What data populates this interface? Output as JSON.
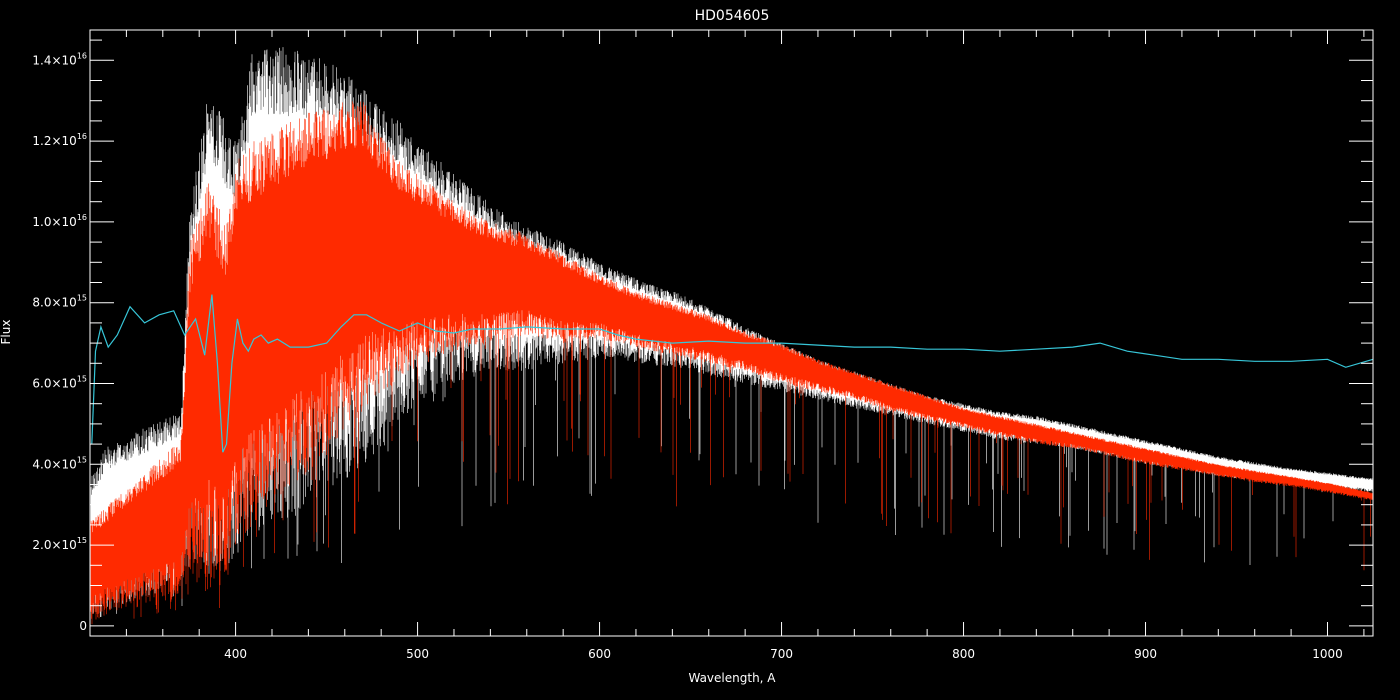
{
  "chart_data": {
    "type": "line",
    "title": "HD054605",
    "xlabel": "Wavelength, A",
    "ylabel": "Flux",
    "xlim": [
      320,
      1025
    ],
    "ylim": [
      -250000000000000.0,
      1.475e+16
    ],
    "grid": false,
    "x_ticks": [
      {
        "value": 400,
        "label": "400"
      },
      {
        "value": 500,
        "label": "500"
      },
      {
        "value": 600,
        "label": "600"
      },
      {
        "value": 700,
        "label": "700"
      },
      {
        "value": 800,
        "label": "800"
      },
      {
        "value": 900,
        "label": "900"
      },
      {
        "value": 1000,
        "label": "1000"
      }
    ],
    "y_ticks": [
      {
        "value": 0,
        "mantissa": "0",
        "exponent": ""
      },
      {
        "value": 2000000000000000.0,
        "mantissa": "2.0×10",
        "exponent": "15"
      },
      {
        "value": 4000000000000000.0,
        "mantissa": "4.0×10",
        "exponent": "15"
      },
      {
        "value": 6000000000000000.0,
        "mantissa": "6.0×10",
        "exponent": "15"
      },
      {
        "value": 8000000000000000.0,
        "mantissa": "8.0×10",
        "exponent": "15"
      },
      {
        "value": 1e+16,
        "mantissa": "1.0×10",
        "exponent": "16"
      },
      {
        "value": 1.2e+16,
        "mantissa": "1.2×10",
        "exponent": "16"
      },
      {
        "value": 1.4e+16,
        "mantissa": "1.4×10",
        "exponent": "16"
      }
    ],
    "series": [
      {
        "color": "#ffffff",
        "envelope_upper": {
          "x": [
            321,
            330,
            350,
            370,
            375,
            385,
            395,
            400,
            410,
            420,
            430,
            440,
            450,
            460,
            470,
            480,
            490,
            500,
            520,
            540,
            560,
            580,
            600,
            620,
            640,
            660,
            680,
            700,
            720,
            740,
            760,
            780,
            800,
            820,
            840,
            860,
            880,
            900,
            920,
            940,
            960,
            980,
            1000,
            1025
          ],
          "y": [
            3800000000000000.0,
            4500000000000000.0,
            4900000000000000.0,
            5300000000000000.0,
            1.05e+16,
            1.32e+16,
            1.25e+16,
            1.2e+16,
            1.44e+16,
            1.44e+16,
            1.43e+16,
            1.42e+16,
            1.4e+16,
            1.37e+16,
            1.33e+16,
            1.28e+16,
            1.25e+16,
            1.2e+16,
            1.12e+16,
            1.05e+16,
            9900000000000000.0,
            9500000000000000.0,
            9000000000000000.0,
            8600000000000000.0,
            8300000000000000.0,
            7900000000000000.0,
            7400000000000000.0,
            7000000000000000.0,
            6600000000000000.0,
            6300000000000000.0,
            6000000000000000.0,
            5700000000000000.0,
            5500000000000000.0,
            5300000000000000.0,
            5200000000000000.0,
            5000000000000000.0,
            4800000000000000.0,
            4600000000000000.0,
            4400000000000000.0,
            4200000000000000.0,
            4050000000000000.0,
            3900000000000000.0,
            3800000000000000.0,
            3650000000000000.0
          ]
        },
        "envelope_lower": {
          "x": [
            321,
            330,
            350,
            370,
            375,
            385,
            395,
            400,
            410,
            420,
            430,
            440,
            450,
            460,
            470,
            480,
            490,
            500,
            520,
            540,
            560,
            580,
            600,
            620,
            640,
            660,
            680,
            700,
            720,
            740,
            760,
            780,
            800,
            820,
            840,
            860,
            880,
            900,
            920,
            940,
            960,
            980,
            1000,
            1025
          ],
          "y": [
            100000000000000.0,
            400000000000000.0,
            700000000000000.0,
            1000000000000000.0,
            1500000000000000.0,
            1500000000000000.0,
            1300000000000000.0,
            1800000000000000.0,
            2300000000000000.0,
            2500000000000000.0,
            2700000000000000.0,
            3000000000000000.0,
            3400000000000000.0,
            3500000000000000.0,
            4000000000000000.0,
            4300000000000000.0,
            5000000000000000.0,
            5500000000000000.0,
            6000000000000000.0,
            6300000000000000.0,
            6300000000000000.0,
            6500000000000000.0,
            6600000000000000.0,
            6500000000000000.0,
            6400000000000000.0,
            6200000000000000.0,
            6000000000000000.0,
            5800000000000000.0,
            5600000000000000.0,
            5400000000000000.0,
            5200000000000000.0,
            5000000000000000.0,
            4800000000000000.0,
            4600000000000000.0,
            4500000000000000.0,
            4400000000000000.0,
            4200000000000000.0,
            4000000000000000.0,
            3900000000000000.0,
            3700000000000000.0,
            3600000000000000.0,
            3500000000000000.0,
            3400000000000000.0,
            3300000000000000.0
          ]
        }
      },
      {
        "color": "#ff2a00",
        "envelope_upper": {
          "x": [
            321,
            330,
            350,
            370,
            375,
            385,
            395,
            400,
            410,
            420,
            430,
            440,
            450,
            460,
            470,
            480,
            490,
            500,
            520,
            540,
            560,
            580,
            600,
            620,
            640,
            660,
            680,
            700,
            720,
            740,
            760,
            780,
            800,
            820,
            840,
            860,
            880,
            900,
            920,
            940,
            960,
            980,
            1000,
            1025
          ],
          "y": [
            2600000000000000.0,
            3000000000000000.0,
            3800000000000000.0,
            4600000000000000.0,
            9500000000000000.0,
            1.1e+16,
            1e+16,
            1.15e+16,
            1.2e+16,
            1.22e+16,
            1.25e+16,
            1.27e+16,
            1.28e+16,
            1.3e+16,
            1.3e+16,
            1.22e+16,
            1.15e+16,
            1.12e+16,
            1.05e+16,
            1e+16,
            9700000000000000.0,
            9200000000000000.0,
            8700000000000000.0,
            8300000000000000.0,
            8000000000000000.0,
            7700000000000000.0,
            7300000000000000.0,
            7000000000000000.0,
            6600000000000000.0,
            6300000000000000.0,
            6000000000000000.0,
            5700000000000000.0,
            5400000000000000.0,
            5200000000000000.0,
            5000000000000000.0,
            4800000000000000.0,
            4600000000000000.0,
            4400000000000000.0,
            4200000000000000.0,
            4000000000000000.0,
            3850000000000000.0,
            3700000000000000.0,
            3550000000000000.0,
            3300000000000000.0
          ]
        },
        "envelope_lower": {
          "x": [
            321,
            330,
            350,
            370,
            375,
            385,
            395,
            400,
            410,
            420,
            430,
            440,
            450,
            460,
            470,
            480,
            490,
            500,
            520,
            540,
            560,
            580,
            600,
            620,
            640,
            660,
            680,
            700,
            720,
            740,
            760,
            780,
            800,
            820,
            840,
            860,
            880,
            900,
            920,
            940,
            960,
            980,
            1000,
            1025
          ],
          "y": [
            100000000000000.0,
            300000000000000.0,
            500000000000000.0,
            700000000000000.0,
            1000000000000000.0,
            1200000000000000.0,
            900000000000000.0,
            2000000000000000.0,
            2500000000000000.0,
            3000000000000000.0,
            3400000000000000.0,
            3800000000000000.0,
            4200000000000000.0,
            4800000000000000.0,
            5300000000000000.0,
            5800000000000000.0,
            6000000000000000.0,
            6400000000000000.0,
            6800000000000000.0,
            7000000000000000.0,
            7200000000000000.0,
            7000000000000000.0,
            7100000000000000.0,
            6900000000000000.0,
            6700000000000000.0,
            6500000000000000.0,
            6300000000000000.0,
            6000000000000000.0,
            5800000000000000.0,
            5600000000000000.0,
            5300000000000000.0,
            5100000000000000.0,
            4900000000000000.0,
            4700000000000000.0,
            4500000000000000.0,
            4400000000000000.0,
            4200000000000000.0,
            4000000000000000.0,
            3850000000000000.0,
            3700000000000000.0,
            3550000000000000.0,
            3450000000000000.0,
            3300000000000000.0,
            3100000000000000.0
          ]
        }
      },
      {
        "color": "#37c6d8",
        "x": [
          321,
          323,
          326,
          330,
          335,
          342,
          350,
          358,
          366,
          372,
          378,
          383,
          387,
          390,
          393,
          395,
          398,
          401,
          404,
          407,
          410,
          414,
          418,
          423,
          430,
          440,
          450,
          458,
          465,
          472,
          480,
          490,
          500,
          510,
          520,
          530,
          545,
          560,
          580,
          600,
          610,
          620,
          640,
          660,
          680,
          700,
          720,
          740,
          760,
          780,
          800,
          820,
          840,
          860,
          875,
          890,
          905,
          920,
          940,
          960,
          980,
          1000,
          1010,
          1025
        ],
        "y": [
          4500000000000000.0,
          6800000000000000.0,
          7400000000000000.0,
          6900000000000000.0,
          7200000000000000.0,
          7900000000000000.0,
          7500000000000000.0,
          7700000000000000.0,
          7800000000000000.0,
          7200000000000000.0,
          7600000000000000.0,
          6700000000000000.0,
          8200000000000000.0,
          6500000000000000.0,
          4300000000000000.0,
          4500000000000000.0,
          6500000000000000.0,
          7600000000000000.0,
          7000000000000000.0,
          6800000000000000.0,
          7100000000000000.0,
          7200000000000000.0,
          7000000000000000.0,
          7100000000000000.0,
          6900000000000000.0,
          6900000000000000.0,
          7000000000000000.0,
          7400000000000000.0,
          7700000000000000.0,
          7700000000000000.0,
          7500000000000000.0,
          7300000000000000.0,
          7500000000000000.0,
          7300000000000000.0,
          7250000000000000.0,
          7350000000000000.0,
          7350000000000000.0,
          7400000000000000.0,
          7350000000000000.0,
          7350000000000000.0,
          7200000000000000.0,
          7100000000000000.0,
          7000000000000000.0,
          7050000000000000.0,
          7000000000000000.0,
          7000000000000000.0,
          6950000000000000.0,
          6900000000000000.0,
          6900000000000000.0,
          6850000000000000.0,
          6850000000000000.0,
          6800000000000000.0,
          6850000000000000.0,
          6900000000000000.0,
          7000000000000000.0,
          6800000000000000.0,
          6700000000000000.0,
          6600000000000000.0,
          6600000000000000.0,
          6550000000000000.0,
          6550000000000000.0,
          6600000000000000.0,
          6400000000000000.0,
          6600000000000000.0
        ]
      }
    ]
  }
}
